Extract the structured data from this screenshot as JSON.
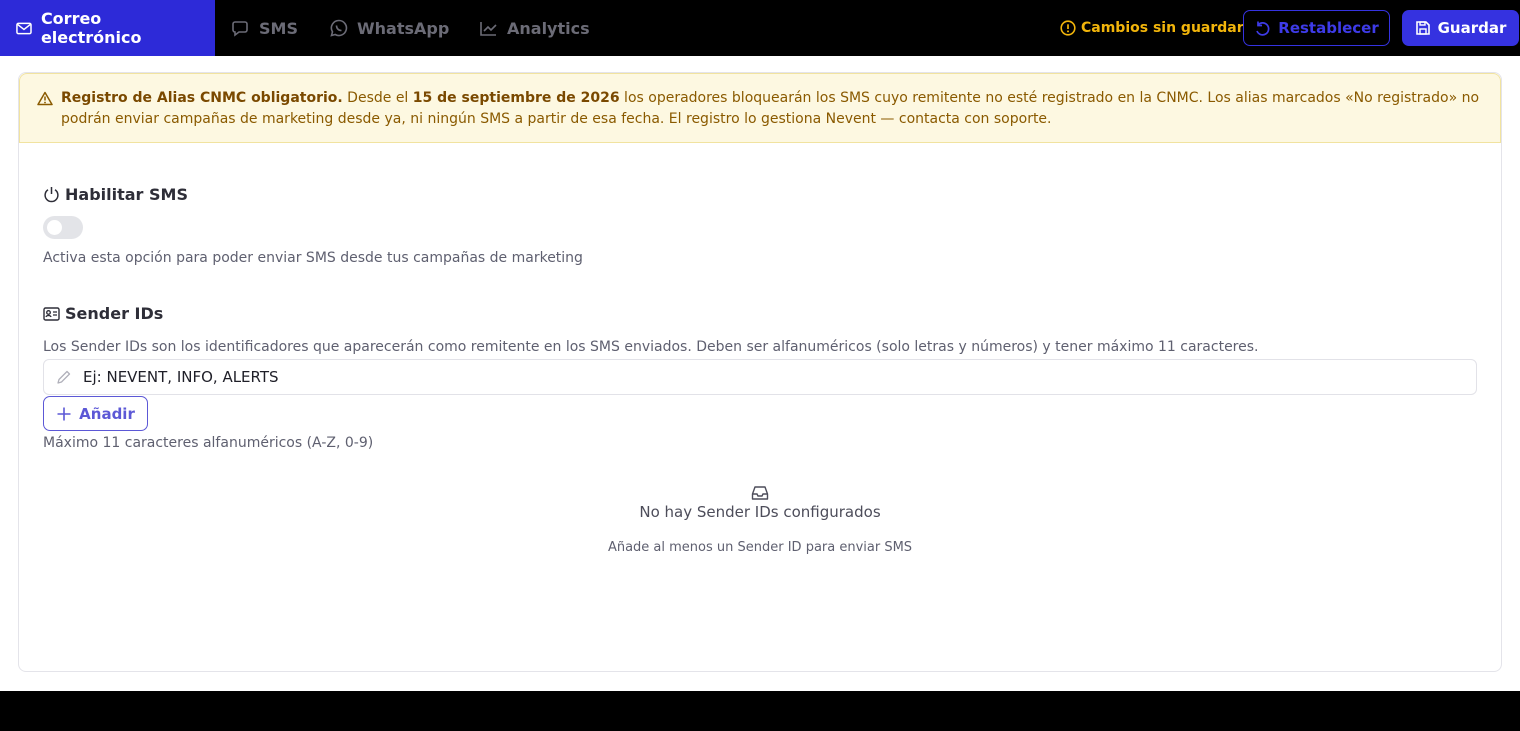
{
  "tabs": [
    {
      "label": "Correo electrónico",
      "icon": "mail-icon",
      "active": true
    },
    {
      "label": "SMS",
      "icon": "chat-icon",
      "active": false
    },
    {
      "label": "WhatsApp",
      "icon": "whatsapp-icon",
      "active": false
    },
    {
      "label": "Analytics",
      "icon": "chart-icon",
      "active": false
    }
  ],
  "header": {
    "unsaved_label": "Cambios sin guardar",
    "reset_label": "Restablecer",
    "save_label": "Guardar"
  },
  "alert": {
    "title": "Registro de Alias CNMC obligatorio.",
    "text_before_date": " Desde el ",
    "date": "15 de septiembre de 2026",
    "text_after_date": " los operadores bloquearán los SMS cuyo remitente no esté registrado en la CNMC. Los alias marcados «No registrado» no podrán enviar campañas de marketing desde ya, ni ningún SMS a partir de esa fecha. El registro lo gestiona Nevent — contacta con soporte."
  },
  "enable_sms": {
    "title": "Habilitar SMS",
    "enabled": false,
    "help": "Activa esta opción para poder enviar SMS desde tus campañas de marketing"
  },
  "sender_ids": {
    "title": "Sender IDs",
    "description": "Los Sender IDs son los identificadores que aparecerán como remitente en los SMS enviados. Deben ser alfanuméricos (solo letras y números) y tener máximo 11 caracteres.",
    "input_placeholder": "Ej: NEVENT, INFO, ALERTS",
    "add_label": "Añadir",
    "hint": "Máximo 11 caracteres alfanuméricos (A-Z, 0-9)",
    "empty_title": "No hay Sender IDs configurados",
    "empty_subtitle": "Añade al menos un Sender ID para enviar SMS"
  },
  "colors": {
    "accent": "#3532e0",
    "warning": "#f2b50b",
    "alert_bg": "#fdf8e1"
  }
}
